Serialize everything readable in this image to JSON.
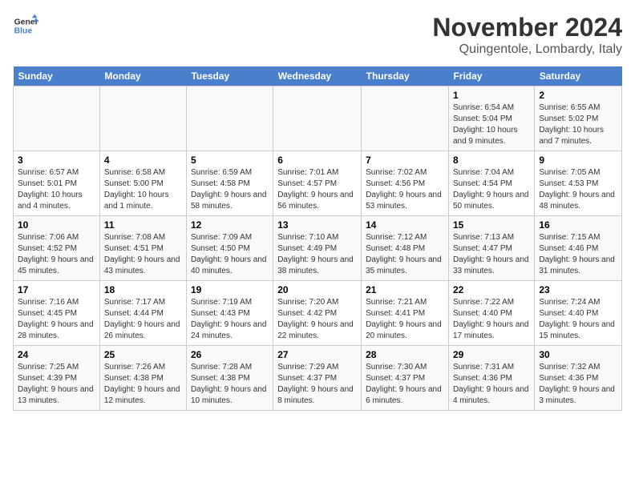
{
  "logo": {
    "line1": "General",
    "line2": "Blue"
  },
  "title": "November 2024",
  "subtitle": "Quingentole, Lombardy, Italy",
  "weekdays": [
    "Sunday",
    "Monday",
    "Tuesday",
    "Wednesday",
    "Thursday",
    "Friday",
    "Saturday"
  ],
  "weeks": [
    [
      {
        "day": "",
        "info": ""
      },
      {
        "day": "",
        "info": ""
      },
      {
        "day": "",
        "info": ""
      },
      {
        "day": "",
        "info": ""
      },
      {
        "day": "",
        "info": ""
      },
      {
        "day": "1",
        "info": "Sunrise: 6:54 AM\nSunset: 5:04 PM\nDaylight: 10 hours and 9 minutes."
      },
      {
        "day": "2",
        "info": "Sunrise: 6:55 AM\nSunset: 5:02 PM\nDaylight: 10 hours and 7 minutes."
      }
    ],
    [
      {
        "day": "3",
        "info": "Sunrise: 6:57 AM\nSunset: 5:01 PM\nDaylight: 10 hours and 4 minutes."
      },
      {
        "day": "4",
        "info": "Sunrise: 6:58 AM\nSunset: 5:00 PM\nDaylight: 10 hours and 1 minute."
      },
      {
        "day": "5",
        "info": "Sunrise: 6:59 AM\nSunset: 4:58 PM\nDaylight: 9 hours and 58 minutes."
      },
      {
        "day": "6",
        "info": "Sunrise: 7:01 AM\nSunset: 4:57 PM\nDaylight: 9 hours and 56 minutes."
      },
      {
        "day": "7",
        "info": "Sunrise: 7:02 AM\nSunset: 4:56 PM\nDaylight: 9 hours and 53 minutes."
      },
      {
        "day": "8",
        "info": "Sunrise: 7:04 AM\nSunset: 4:54 PM\nDaylight: 9 hours and 50 minutes."
      },
      {
        "day": "9",
        "info": "Sunrise: 7:05 AM\nSunset: 4:53 PM\nDaylight: 9 hours and 48 minutes."
      }
    ],
    [
      {
        "day": "10",
        "info": "Sunrise: 7:06 AM\nSunset: 4:52 PM\nDaylight: 9 hours and 45 minutes."
      },
      {
        "day": "11",
        "info": "Sunrise: 7:08 AM\nSunset: 4:51 PM\nDaylight: 9 hours and 43 minutes."
      },
      {
        "day": "12",
        "info": "Sunrise: 7:09 AM\nSunset: 4:50 PM\nDaylight: 9 hours and 40 minutes."
      },
      {
        "day": "13",
        "info": "Sunrise: 7:10 AM\nSunset: 4:49 PM\nDaylight: 9 hours and 38 minutes."
      },
      {
        "day": "14",
        "info": "Sunrise: 7:12 AM\nSunset: 4:48 PM\nDaylight: 9 hours and 35 minutes."
      },
      {
        "day": "15",
        "info": "Sunrise: 7:13 AM\nSunset: 4:47 PM\nDaylight: 9 hours and 33 minutes."
      },
      {
        "day": "16",
        "info": "Sunrise: 7:15 AM\nSunset: 4:46 PM\nDaylight: 9 hours and 31 minutes."
      }
    ],
    [
      {
        "day": "17",
        "info": "Sunrise: 7:16 AM\nSunset: 4:45 PM\nDaylight: 9 hours and 28 minutes."
      },
      {
        "day": "18",
        "info": "Sunrise: 7:17 AM\nSunset: 4:44 PM\nDaylight: 9 hours and 26 minutes."
      },
      {
        "day": "19",
        "info": "Sunrise: 7:19 AM\nSunset: 4:43 PM\nDaylight: 9 hours and 24 minutes."
      },
      {
        "day": "20",
        "info": "Sunrise: 7:20 AM\nSunset: 4:42 PM\nDaylight: 9 hours and 22 minutes."
      },
      {
        "day": "21",
        "info": "Sunrise: 7:21 AM\nSunset: 4:41 PM\nDaylight: 9 hours and 20 minutes."
      },
      {
        "day": "22",
        "info": "Sunrise: 7:22 AM\nSunset: 4:40 PM\nDaylight: 9 hours and 17 minutes."
      },
      {
        "day": "23",
        "info": "Sunrise: 7:24 AM\nSunset: 4:40 PM\nDaylight: 9 hours and 15 minutes."
      }
    ],
    [
      {
        "day": "24",
        "info": "Sunrise: 7:25 AM\nSunset: 4:39 PM\nDaylight: 9 hours and 13 minutes."
      },
      {
        "day": "25",
        "info": "Sunrise: 7:26 AM\nSunset: 4:38 PM\nDaylight: 9 hours and 12 minutes."
      },
      {
        "day": "26",
        "info": "Sunrise: 7:28 AM\nSunset: 4:38 PM\nDaylight: 9 hours and 10 minutes."
      },
      {
        "day": "27",
        "info": "Sunrise: 7:29 AM\nSunset: 4:37 PM\nDaylight: 9 hours and 8 minutes."
      },
      {
        "day": "28",
        "info": "Sunrise: 7:30 AM\nSunset: 4:37 PM\nDaylight: 9 hours and 6 minutes."
      },
      {
        "day": "29",
        "info": "Sunrise: 7:31 AM\nSunset: 4:36 PM\nDaylight: 9 hours and 4 minutes."
      },
      {
        "day": "30",
        "info": "Sunrise: 7:32 AM\nSunset: 4:36 PM\nDaylight: 9 hours and 3 minutes."
      }
    ]
  ]
}
